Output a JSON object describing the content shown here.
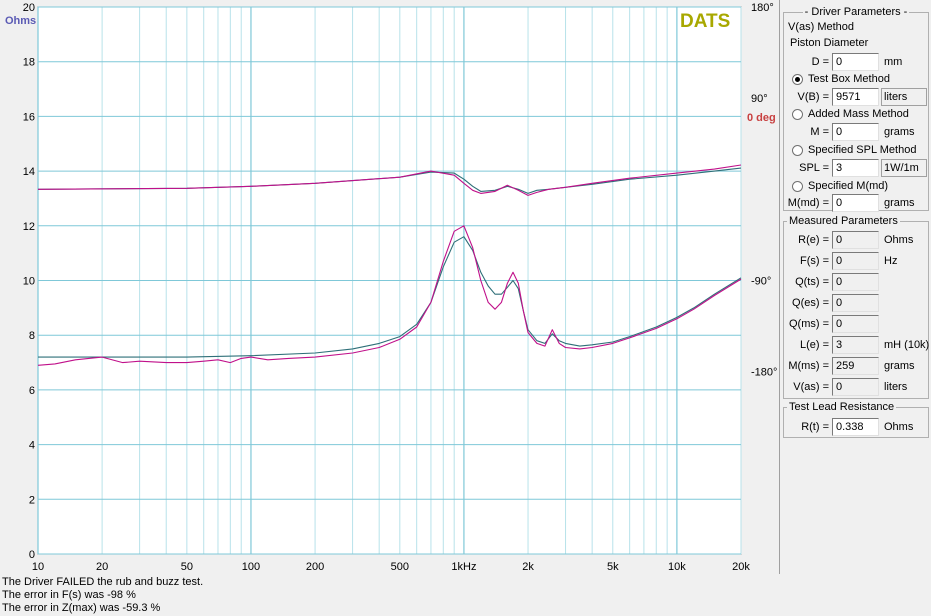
{
  "chart": {
    "brand": "DATS",
    "left_unit": "Ohms",
    "right_unit": "0 deg",
    "y_ticks": [
      "20",
      "18",
      "16",
      "14",
      "12",
      "10",
      "8",
      "6",
      "4",
      "2",
      "0"
    ],
    "phase_ticks": [
      "180°",
      "90°",
      "-90°",
      "-180°"
    ],
    "x_ticks": [
      "10",
      "20",
      "50",
      "100",
      "200",
      "500",
      "1kHz",
      "2k",
      "5k",
      "10k",
      "20k"
    ]
  },
  "chart_data": {
    "type": "line",
    "xscale": "log",
    "xlim": [
      10,
      20000
    ],
    "ylim": [
      0,
      20
    ],
    "y2lim": [
      -360,
      180
    ],
    "grid": true,
    "series": [
      {
        "axis": "impedance",
        "color": "#2e6f78",
        "x": [
          10,
          20,
          50,
          100,
          200,
          300,
          400,
          500,
          600,
          700,
          800,
          900,
          1000,
          1100,
          1200,
          1300,
          1400,
          1500,
          1600,
          1700,
          1800,
          1900,
          2000,
          2200,
          2400,
          2600,
          2800,
          3000,
          3500,
          4000,
          5000,
          6000,
          8000,
          10000,
          12000,
          15000,
          20000
        ],
        "y": [
          7.2,
          7.2,
          7.2,
          7.25,
          7.35,
          7.5,
          7.7,
          7.95,
          8.4,
          9.2,
          10.5,
          11.4,
          11.6,
          11.1,
          10.3,
          9.8,
          9.5,
          9.5,
          9.75,
          10.0,
          9.7,
          8.9,
          8.2,
          7.8,
          7.7,
          8.05,
          7.8,
          7.7,
          7.6,
          7.65,
          7.75,
          7.95,
          8.3,
          8.65,
          9.0,
          9.5,
          10.1
        ]
      },
      {
        "axis": "impedance",
        "color": "#c0108a",
        "x": [
          10,
          12,
          15,
          20,
          25,
          30,
          40,
          50,
          60,
          70,
          80,
          90,
          100,
          120,
          150,
          200,
          300,
          400,
          500,
          600,
          700,
          800,
          900,
          1000,
          1100,
          1200,
          1300,
          1400,
          1500,
          1600,
          1700,
          1800,
          1900,
          2000,
          2200,
          2400,
          2600,
          2800,
          3000,
          3500,
          4000,
          5000,
          6000,
          8000,
          10000,
          12000,
          15000,
          20000
        ],
        "y": [
          6.9,
          6.95,
          7.1,
          7.2,
          7.0,
          7.05,
          7.0,
          7.0,
          7.05,
          7.1,
          7.0,
          7.15,
          7.2,
          7.1,
          7.15,
          7.2,
          7.35,
          7.55,
          7.85,
          8.3,
          9.2,
          10.7,
          11.8,
          12.0,
          11.2,
          10.0,
          9.2,
          8.95,
          9.2,
          9.9,
          10.3,
          9.9,
          8.9,
          8.1,
          7.7,
          7.6,
          8.2,
          7.7,
          7.55,
          7.5,
          7.55,
          7.7,
          7.9,
          8.25,
          8.6,
          8.95,
          9.45,
          10.05
        ]
      },
      {
        "axis": "phase",
        "color": "#2e6f78",
        "x": [
          10,
          50,
          100,
          200,
          500,
          700,
          900,
          1000,
          1100,
          1200,
          1400,
          1600,
          1800,
          2000,
          2200,
          2500,
          3000,
          4000,
          6000,
          10000,
          15000,
          20000
        ],
        "y": [
          0,
          1,
          3,
          6,
          12,
          17,
          16,
          10,
          3,
          -2,
          -1,
          3,
          0,
          -4,
          -1,
          0,
          2,
          5,
          10,
          14,
          18,
          21
        ]
      },
      {
        "axis": "phase",
        "color": "#c0108a",
        "x": [
          10,
          50,
          100,
          200,
          500,
          700,
          900,
          1000,
          1100,
          1200,
          1400,
          1600,
          1800,
          2000,
          2200,
          2500,
          3000,
          4000,
          6000,
          10000,
          15000,
          20000
        ],
        "y": [
          0,
          1,
          3,
          6,
          12,
          18,
          14,
          6,
          -1,
          -4,
          -2,
          4,
          -1,
          -6,
          -3,
          0,
          2,
          6,
          11,
          16,
          20,
          24
        ]
      }
    ]
  },
  "status": {
    "line1": "The Driver FAILED the rub and buzz test.",
    "line2": "The error in F(s) was -98 %",
    "line3": "The error in Z(max) was -59.3 %"
  },
  "driver_params": {
    "title": "- Driver Parameters -",
    "vas_method": "V(as) Method",
    "piston_diameter": "Piston Diameter",
    "d_label": "D =",
    "d_value": "0",
    "d_unit": "mm",
    "test_box": "Test Box Method",
    "vb_label": "V(B) =",
    "vb_value": "9571",
    "vb_unit": "liters",
    "added_mass": "Added Mass Method",
    "m_label": "M =",
    "m_value": "0",
    "m_unit": "grams",
    "spec_spl": "Specified SPL Method",
    "spl_label": "SPL =",
    "spl_value": "3",
    "spl_unit": "1W/1m",
    "spec_mmd": "Specified M(md)",
    "mmd_label": "M(md) =",
    "mmd_value": "0",
    "mmd_unit": "grams"
  },
  "measured": {
    "title": "Measured Parameters",
    "rows": [
      {
        "label": "R(e) =",
        "value": "0",
        "unit": "Ohms"
      },
      {
        "label": "F(s) =",
        "value": "0",
        "unit": "Hz"
      },
      {
        "label": "Q(ts) =",
        "value": "0",
        "unit": ""
      },
      {
        "label": "Q(es) =",
        "value": "0",
        "unit": ""
      },
      {
        "label": "Q(ms) =",
        "value": "0",
        "unit": ""
      },
      {
        "label": "L(e) =",
        "value": "3",
        "unit": "mH (10k)"
      },
      {
        "label": "M(ms) =",
        "value": "259",
        "unit": "grams"
      },
      {
        "label": "V(as) =",
        "value": "0",
        "unit": "liters"
      }
    ]
  },
  "lead": {
    "title": "Test Lead Resistance",
    "label": "R(t) =",
    "value": "0.338",
    "unit": "Ohms"
  }
}
